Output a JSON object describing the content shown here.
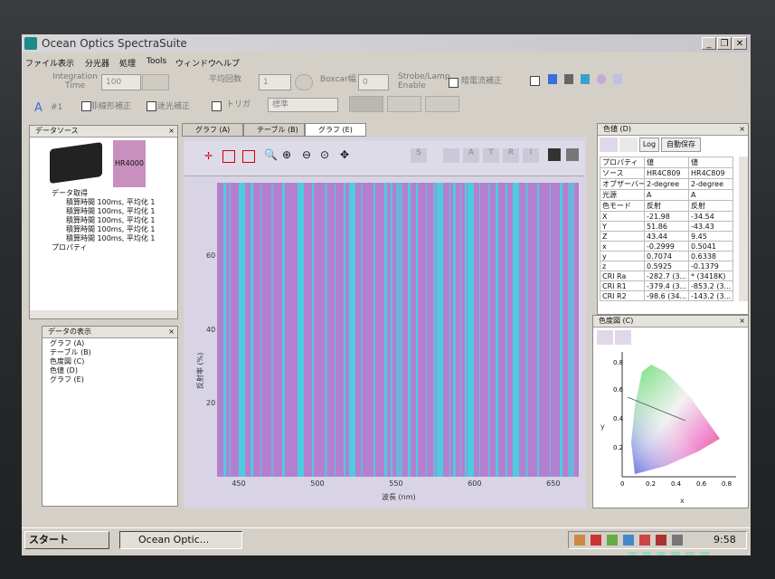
{
  "window": {
    "title": "Ocean Optics SpectraSuite"
  },
  "menu": [
    "ファイル",
    "表示",
    "分光器",
    "処理",
    "Tools",
    "ウィンドウ",
    "ヘルプ"
  ],
  "toolbar": {
    "integration_label": "Integration Time",
    "integration_value": "100",
    "scans_avg_label": "平均回数",
    "scans_avg_value": "1",
    "boxcar_label": "Boxcar幅",
    "boxcar_value": "0",
    "strobe_label": "Strobe/Lamp Enable",
    "dark_label": "暗電流補正",
    "nonlinear_label": "非線形補正",
    "stray_label": "迷光補正",
    "trigger_label": "トリガ",
    "trigger_mode": "標準",
    "channel_label": "#1"
  },
  "data_source_panel": {
    "title": "データソース",
    "device": "HR4000",
    "acquisition": "データ取得",
    "items": [
      "積算時間 100ms, 平均化 1",
      "積算時間 100ms, 平均化 1",
      "積算時間 100ms, 平均化 1",
      "積算時間 100ms, 平均化 1",
      "積算時間 100ms, 平均化 1"
    ],
    "properties": "プロパティ"
  },
  "data_view_panel": {
    "title": "データの表示",
    "items": [
      "グラフ (A)",
      "テーブル (B)",
      "色度図 (C)",
      "色値 (D)",
      "グラフ (E)"
    ]
  },
  "tabs": [
    "グラフ (A)",
    "テーブル (B)",
    "グラフ (E)"
  ],
  "chart_data": {
    "type": "line",
    "xlabel": "波長 (nm)",
    "ylabel": "反射率 (%)",
    "xlim": [
      436,
      666
    ],
    "ylim": [
      0,
      80
    ],
    "xticks": [
      450,
      500,
      550,
      600,
      650
    ],
    "yticks": [
      20,
      40,
      60
    ],
    "line_color": "#3fd6e0",
    "background_color": "#b57fd0",
    "vertical_traces_x": [
      441,
      444,
      452,
      458,
      464,
      471,
      478,
      489,
      497,
      505,
      511,
      517,
      522,
      528,
      536,
      543,
      547,
      552,
      558,
      563,
      569,
      574,
      578,
      584,
      587,
      591,
      594,
      597,
      603,
      609,
      614,
      620,
      626,
      633,
      640,
      648,
      655,
      661
    ]
  },
  "color_values_panel": {
    "title": "色値 (D)",
    "buttons": [
      "Log",
      "自動保存"
    ],
    "headers": [
      "プロパティ",
      "値",
      "値"
    ],
    "rows": [
      [
        "ソース",
        "HR4C809",
        "HR4C809"
      ],
      [
        "オブザーバー",
        "2-degree",
        "2-degree"
      ],
      [
        "光源",
        "A",
        "A"
      ],
      [
        "色モード",
        "反射",
        "反射"
      ],
      [
        "X",
        "-21.98",
        "-34.54"
      ],
      [
        "Y",
        "51.86",
        "-43.43"
      ],
      [
        "Z",
        "43.44",
        "9.45"
      ],
      [
        "x",
        "-0.2999",
        "0.5041"
      ],
      [
        "y",
        "0.7074",
        "0.6338"
      ],
      [
        "z",
        "0.5925",
        "-0.1379"
      ],
      [
        "CRI Ra",
        "-282.7 (3...",
        "* (3418K)"
      ],
      [
        "CRI R1",
        "-379.4 (3...",
        "-853.2 (3..."
      ],
      [
        "CRI R2",
        "-98.6 (34...",
        "-143.2 (3..."
      ]
    ]
  },
  "chromaticity_panel": {
    "title": "色度図 (C)",
    "yticks": [
      "0.8",
      "0.6",
      "0.4",
      "0.2"
    ],
    "xticks": [
      "0",
      "0.2",
      "0.4",
      "0.6",
      "0.8"
    ],
    "xlabel": "x",
    "ylabel": "y"
  },
  "taskbar": {
    "start": "スタート",
    "app": "Ocean Optic...",
    "clock": "9:58"
  }
}
